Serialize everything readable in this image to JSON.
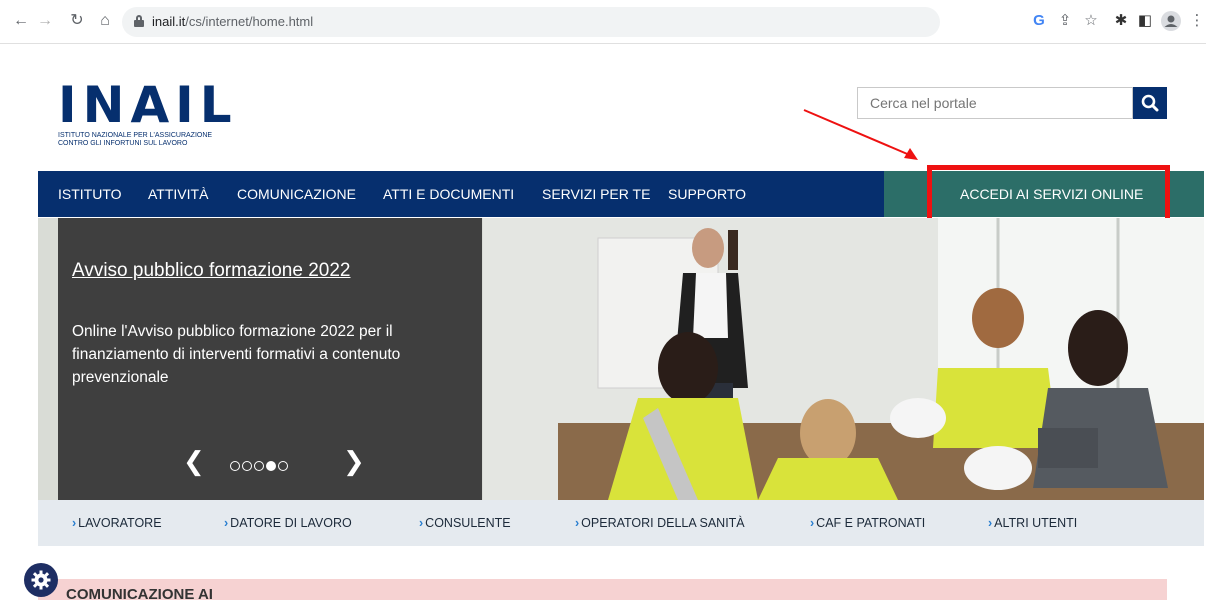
{
  "browser": {
    "url_host": "inail.it",
    "url_path": "/cs/internet/home.html"
  },
  "header": {
    "logo_text": "INAIL",
    "logo_subtitle_1": "ISTITUTO NAZIONALE PER L'ASSICURAZIONE",
    "logo_subtitle_2": "CONTRO GLI INFORTUNI SUL LAVORO",
    "search_placeholder": "Cerca nel portale"
  },
  "nav": {
    "items": [
      {
        "label": "ISTITUTO"
      },
      {
        "label": "ATTIVITÀ"
      },
      {
        "label": "COMUNICAZIONE"
      },
      {
        "label": "ATTI E DOCUMENTI"
      },
      {
        "label": "SERVIZI PER TE"
      },
      {
        "label": "SUPPORTO"
      }
    ],
    "access_label": "ACCEDI AI SERVIZI ONLINE"
  },
  "hero": {
    "title": "Avviso pubblico formazione 2022",
    "text": "Online l'Avviso pubblico formazione 2022 per il finanziamento di interventi formativi a contenuto prevenzionale",
    "slides_total": 5,
    "active_slide": 4
  },
  "audience": {
    "items": [
      {
        "label": "LAVORATORE"
      },
      {
        "label": "DATORE DI LAVORO"
      },
      {
        "label": "CONSULENTE"
      },
      {
        "label": "OPERATORI DELLA SANITÀ"
      },
      {
        "label": "CAF E PATRONATI"
      },
      {
        "label": "ALTRI UTENTI"
      }
    ]
  },
  "notice": {
    "title": "COMUNICAZIONE AI"
  },
  "colors": {
    "brand_blue": "#062f6e",
    "access_green": "#2c6e68",
    "highlight_red": "#ee1111"
  }
}
